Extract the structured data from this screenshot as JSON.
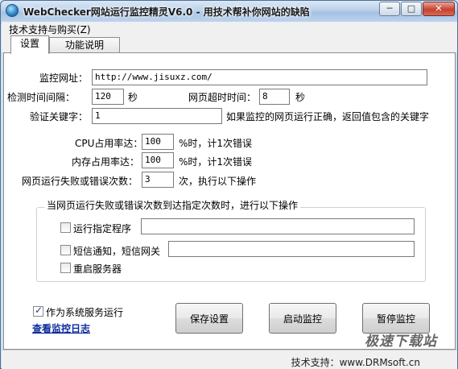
{
  "window": {
    "title": "WebChecker网站运行监控精灵V6.0 - 用技术帮补你网站的缺陷",
    "min_label": "─",
    "max_label": "□",
    "close_label": "✕"
  },
  "menu": {
    "support": "技术支持与购买(Z)"
  },
  "tabs": [
    {
      "label": "设置"
    },
    {
      "label": "功能说明"
    }
  ],
  "settings": {
    "url_label": "监控网址：",
    "url_value": "http://www.jisuxz.com/",
    "interval_label": "检测时间间隔：",
    "interval_value": "120",
    "interval_unit": "秒",
    "timeout_label": "网页超时时间：",
    "timeout_value": "8",
    "timeout_unit": "秒",
    "keyword_label": "验证关键字：",
    "keyword_value": "1",
    "keyword_hint": "如果监控的网页运行正确，返回值包含的关键字",
    "cpu_label": "CPU占用率达：",
    "cpu_value": "100",
    "cpu_hint": "%时，计1次错误",
    "mem_label": "内存占用率达：",
    "mem_value": "100",
    "mem_hint": "%时，计1次错误",
    "fail_label": "网页运行失败或错误次数：",
    "fail_value": "3",
    "fail_hint": "次，执行以下操作"
  },
  "actions_group": {
    "title": "当网页运行失败或错误次数到达指定次数时，进行以下操作",
    "run_program_label": "运行指定程序",
    "run_program_value": "",
    "sms_label": "短信通知，短信网关",
    "sms_value": "",
    "reboot_label": "重启服务器",
    "run_program_checked": false,
    "sms_checked": false,
    "reboot_checked": false
  },
  "service": {
    "label": "作为系统服务运行",
    "checked": true
  },
  "log_link": "查看监控日志",
  "buttons": {
    "save": "保存设置",
    "start": "启动监控",
    "pause": "暂停监控"
  },
  "status": {
    "text": "技术支持：www.DRMsoft.cn"
  },
  "watermark": "极速下载站",
  "colors": {
    "link": "#0c2b9c",
    "titlebar": "#b9d0ea",
    "close": "#c7412f"
  }
}
